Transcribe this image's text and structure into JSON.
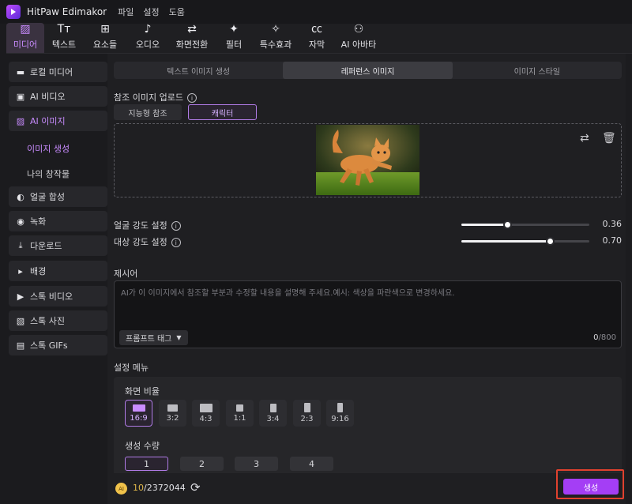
{
  "app": {
    "name": "HitPaw Edimakor",
    "menus": [
      "파일",
      "설정",
      "도움"
    ]
  },
  "toolbar": {
    "items": [
      {
        "label": "미디어",
        "icon": "media-icon",
        "active": true
      },
      {
        "label": "텍스트",
        "icon": "text-icon"
      },
      {
        "label": "요소들",
        "icon": "elements-icon"
      },
      {
        "label": "오디오",
        "icon": "audio-icon"
      },
      {
        "label": "화면전환",
        "icon": "transition-icon"
      },
      {
        "label": "필터",
        "icon": "filter-icon"
      },
      {
        "label": "특수효과",
        "icon": "effects-icon"
      },
      {
        "label": "자막",
        "icon": "subtitle-icon"
      },
      {
        "label": "AI 아바타",
        "icon": "ai-avatar-icon"
      }
    ]
  },
  "sidebar": {
    "items": [
      "로컬 미디어",
      "AI 비디오",
      "AI 이미지",
      "얼굴 합성",
      "녹화",
      "다운로드",
      "배경",
      "스톡 비디오",
      "스톡 사진",
      "스톡 GIFs"
    ],
    "sub_items": [
      "이미지 생성",
      "나의 창작물"
    ]
  },
  "tabs": [
    "텍스트 이미지 생성",
    "레퍼런스 이미지",
    "이미지 스타일"
  ],
  "upload": {
    "label": "참조 이미지 업로드",
    "modes": [
      "지능형 참조",
      "캐릭터"
    ]
  },
  "sliders": [
    {
      "label": "얼굴 강도 설정",
      "value": 0.36
    },
    {
      "label": "대상 강도 설정",
      "value": 0.7
    }
  ],
  "prompt": {
    "label": "제시어",
    "placeholder": "AI가 이 이미지에서 참조할 부분과 수정할 내용을 설명해 주세요.예시: 색상을 파란색으로 변경하세요.",
    "tag_button": "프롬프트 태그",
    "count": "0",
    "max": "/800"
  },
  "settings": {
    "label": "설정 메뉴",
    "ratio_label": "화면 비율",
    "ratios": [
      "16:9",
      "3:2",
      "4:3",
      "1:1",
      "3:4",
      "2:3",
      "9:16"
    ],
    "quantity_label": "생성 수량",
    "quantities": [
      "1",
      "2",
      "3",
      "4"
    ]
  },
  "footer": {
    "credits_current": "10",
    "credits_total": "/2372044",
    "coin_text": "AI",
    "generate": "생성"
  },
  "colors": {
    "accent": "#a43ef5",
    "highlight_border": "#e0412e",
    "selected": "#c98cff"
  }
}
